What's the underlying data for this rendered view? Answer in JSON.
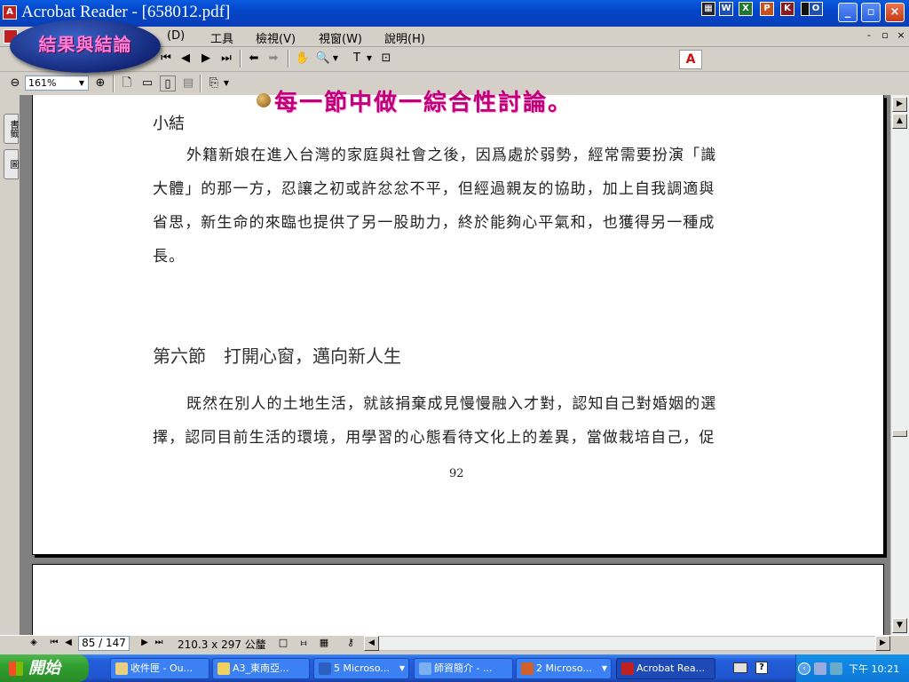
{
  "window": {
    "title": "Acrobat Reader - [658012.pdf]",
    "icon": "pdf-icon",
    "controls": {
      "minimize": "_",
      "maximize": "▫",
      "close": "×"
    }
  },
  "quick_launch": [
    "word-icon",
    "excel-icon",
    "powerpoint-icon",
    "access-icon",
    "outlook-icon",
    "binder-icon"
  ],
  "menu": {
    "items": [
      "檢視(V)",
      "視窗(W)",
      "說明(H)"
    ],
    "tools_label": "工具",
    "document_label": "(D)",
    "mdi_controls": [
      "-",
      "▫",
      "×"
    ]
  },
  "toolbar2": {
    "zoom": "161%"
  },
  "slide_overlay": {
    "badge_text": "結果與結論",
    "heading": "每一節中做一綜合性討論。"
  },
  "side_tabs": [
    "書籤",
    "圖"
  ],
  "document": {
    "section_title": "小結",
    "paragraph1": [
      "外籍新娘在進入台灣的家庭與社會之後，因爲處於弱勢，經常需要扮演「識",
      "大體」的那一方，忍讓之初或許忿忿不平，但經過親友的協助，加上自我調適與",
      "省思，新生命的來臨也提供了另一股助力，終於能夠心平氣和，也獲得另一種成",
      "長。"
    ],
    "section_heading": "第六節　打開心窗，邁向新人生",
    "paragraph2": [
      "既然在別人的土地生活，就該捐棄成見慢慢融入才對，認知自己對婚姻的選",
      "擇，認同目前生活的環境，用學習的心態看待文化上的差異，當做栽培自己，促"
    ],
    "page_number": "92"
  },
  "statusbar": {
    "page_indicator": "85 / 147",
    "page_size": "210.3 x 297 公釐"
  },
  "taskbar": {
    "start_label": "開始",
    "tasks": [
      {
        "label": "收件匣 - Ou...",
        "icon": "outlook-icon",
        "active": false
      },
      {
        "label": "A3_東南亞...",
        "icon": "folder-icon",
        "active": false
      },
      {
        "label": "5 Microso...",
        "icon": "word-icon",
        "active": false
      },
      {
        "label": "師資簡介 - ...",
        "icon": "ie-icon",
        "active": false
      },
      {
        "label": "2 Microso...",
        "icon": "powerpoint-icon",
        "active": false
      },
      {
        "label": "Acrobat Rea...",
        "icon": "pdf-icon",
        "active": true
      }
    ],
    "clock": "下午 10:21"
  },
  "colors": {
    "titlebar": "#0a5be0",
    "slide_heading": "#c0007a",
    "slide_badge_text": "#ff7fd8",
    "taskbar": "#245edb",
    "start_button": "#30a030"
  }
}
